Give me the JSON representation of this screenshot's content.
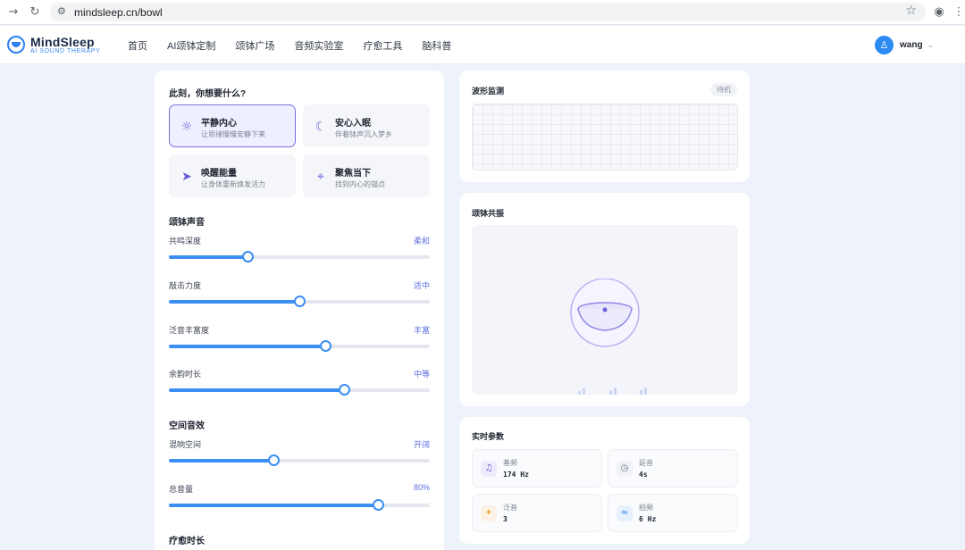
{
  "browser": {
    "url": "mindsleep.cn/bowl"
  },
  "brand": {
    "name": "MindSleep",
    "tagline": "AI SOUND THERAPY"
  },
  "nav": [
    "首页",
    "AI颂钵定制",
    "颂钵广场",
    "音频实验室",
    "疗愈工具",
    "脑科普"
  ],
  "user": {
    "name": "wang"
  },
  "left": {
    "question": "此刻，你想要什么?",
    "moods": [
      {
        "title": "平静内心",
        "subtitle": "让思绪慢慢安静下来",
        "icon": "sun-icon",
        "selected": true
      },
      {
        "title": "安心入眠",
        "subtitle": "伴着钵声沉入梦乡",
        "icon": "moon-icon",
        "selected": false
      },
      {
        "title": "唤醒能量",
        "subtitle": "让身体重新焕发活力",
        "icon": "paper-plane-icon",
        "selected": false
      },
      {
        "title": "聚焦当下",
        "subtitle": "找到内心的锚点",
        "icon": "crosshair-icon",
        "selected": false
      }
    ],
    "bowl_sound": {
      "title": "颂钵声音",
      "sliders": [
        {
          "label": "共鸣深度",
          "value": "柔和",
          "level": 0.3
        },
        {
          "label": "敲击力度",
          "value": "适中",
          "level": 0.5
        },
        {
          "label": "泛音丰富度",
          "value": "丰富",
          "level": 0.6
        },
        {
          "label": "余韵时长",
          "value": "中等",
          "level": 0.67
        }
      ]
    },
    "spatial": {
      "title": "空间音效",
      "sliders": [
        {
          "label": "混响空间",
          "value": "开阔",
          "level": 0.4
        },
        {
          "label": "总音量",
          "value": "80%",
          "level": 0.8
        }
      ]
    },
    "duration_title": "疗愈时长"
  },
  "waveform": {
    "title": "波形监测",
    "status": "待机"
  },
  "resonance": {
    "title": "颂钵共振"
  },
  "params": {
    "title": "实时参数",
    "items": [
      {
        "label": "基频",
        "value": "174 Hz",
        "icon": "music-note-icon"
      },
      {
        "label": "延音",
        "value": "4s",
        "icon": "timer-icon"
      },
      {
        "label": "泛音",
        "value": "3",
        "icon": "sparkle-icon"
      },
      {
        "label": "拍频",
        "value": "6 Hz",
        "icon": "wave-icon"
      }
    ]
  },
  "colors": {
    "accent": "#3b8ef2",
    "purple": "#6a5fd8",
    "bg": "#eef2fb"
  }
}
